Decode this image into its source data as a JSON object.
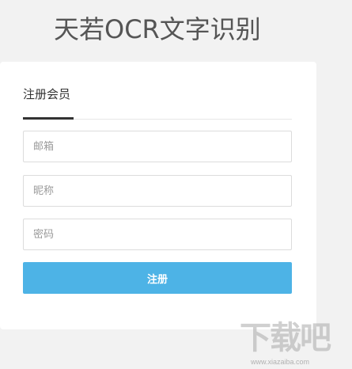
{
  "header": {
    "title": "天若OCR文字识别"
  },
  "register": {
    "tab_label": "注册会员",
    "email_placeholder": "邮箱",
    "nickname_placeholder": "昵称",
    "password_placeholder": "密码",
    "submit_label": "注册"
  },
  "watermark": {
    "text": "下载吧",
    "url": "www.xiazaiba.com"
  },
  "colors": {
    "accent": "#4db3e6",
    "background": "#f2f2f2",
    "card": "#ffffff"
  }
}
